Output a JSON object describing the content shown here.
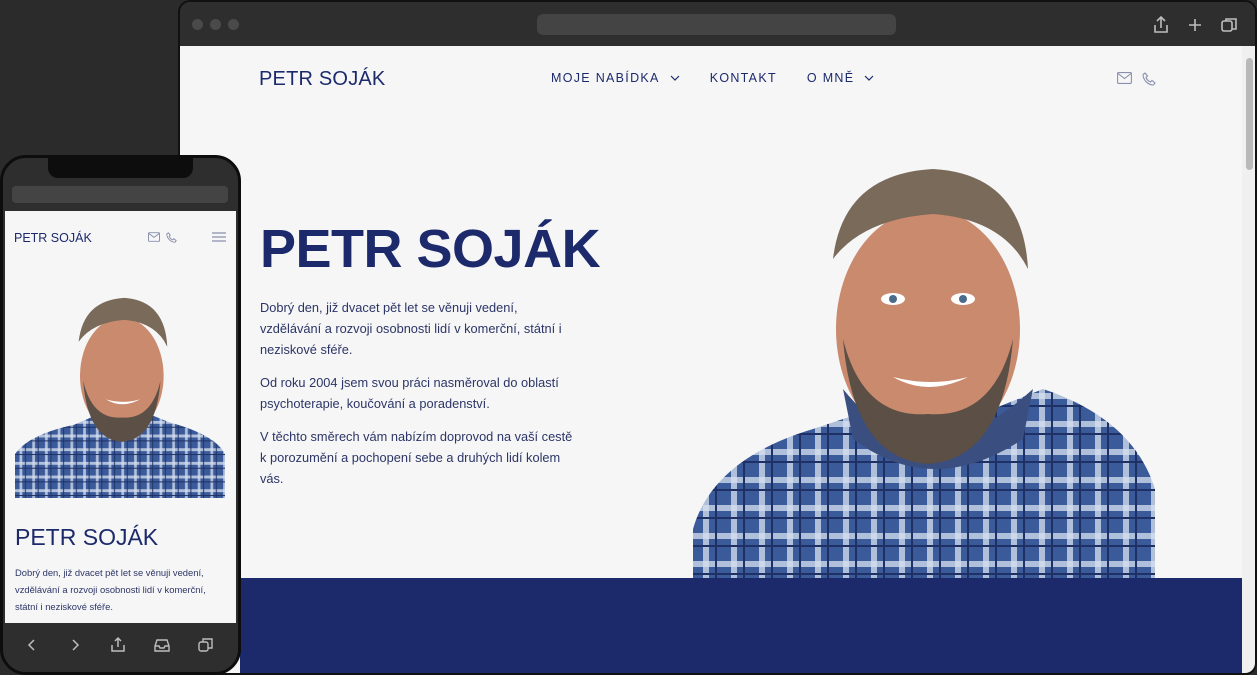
{
  "site": {
    "logo": "PETR SOJÁK",
    "nav": [
      {
        "label": "MOJE NABÍDKA",
        "has_dropdown": true
      },
      {
        "label": "KONTAKT",
        "has_dropdown": false
      },
      {
        "label": "O MNĚ",
        "has_dropdown": true
      }
    ],
    "header_icons": [
      "mail-icon",
      "phone-icon"
    ],
    "hero": {
      "title": "PETR SOJÁK",
      "paragraphs": [
        "Dobrý den, již dvacet pět let se věnuji vedení, vzdělávání a rozvoji osobnosti lidí v komerční, státní i neziskové sféře.",
        "Od roku 2004 jsem svou práci nasměroval do oblastí psychoterapie, koučování a poradenství.",
        "V těchto směrech vám nabízím doprovod na vaší cestě k porozumění a pochopení sebe a druhých lidí kolem vás."
      ]
    }
  },
  "mobile": {
    "logo": "PETR SOJÁK",
    "title": "PETR SOJÁK",
    "paragraph": "Dobrý den, již dvacet pět let se věnuji vedení, vzdělávání a rozvoji osobnosti lidí v komerční, státní i neziskové sféře."
  },
  "browser_icons": [
    "share-icon",
    "new-tab-icon",
    "tabs-icon"
  ],
  "mobile_toolbar_icons": [
    "back-icon",
    "forward-icon",
    "share-icon",
    "inbox-icon",
    "tabs-icon"
  ],
  "colors": {
    "brand": "#1c2a6b",
    "page_bg": "#f6f6f7",
    "frame": "#2e2e2e",
    "shirt_blue": "#3a5a9a",
    "skin": "#c98a6e"
  }
}
